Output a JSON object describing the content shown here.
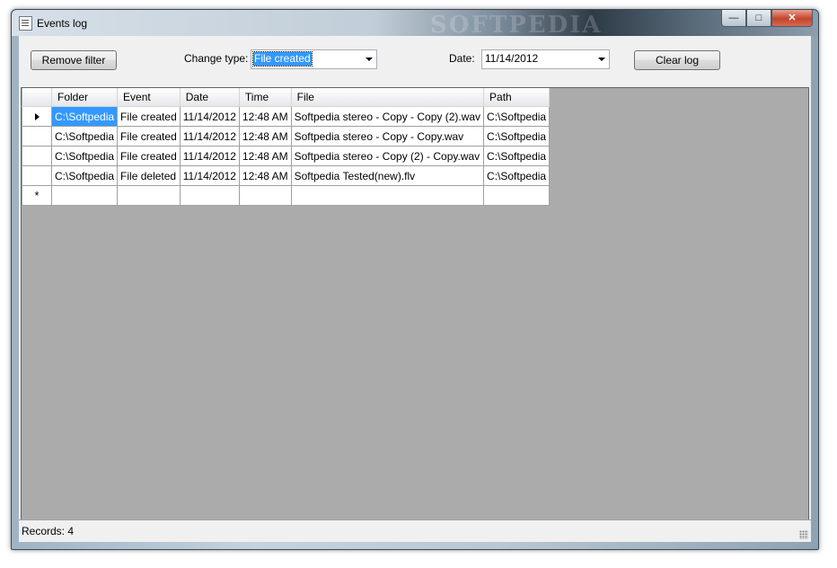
{
  "window": {
    "title": "Events log",
    "controls": {
      "minimize": "—",
      "maximize": "□",
      "close": "✕"
    }
  },
  "toolbar": {
    "remove_filter_label": "Remove filter",
    "change_type_label": "Change type:",
    "change_type_value": "File created",
    "date_label": "Date:",
    "date_value": "11/14/2012",
    "clear_log_label": "Clear log"
  },
  "grid": {
    "columns": [
      "Folder",
      "Event",
      "Date",
      "Time",
      "File",
      "Path"
    ],
    "rows": [
      [
        "C:\\Softpedia",
        "File created",
        "11/14/2012",
        "12:48 AM",
        "Softpedia stereo - Copy - Copy (2).wav",
        "C:\\Softpedia"
      ],
      [
        "C:\\Softpedia",
        "File created",
        "11/14/2012",
        "12:48 AM",
        "Softpedia stereo - Copy - Copy.wav",
        "C:\\Softpedia"
      ],
      [
        "C:\\Softpedia",
        "File created",
        "11/14/2012",
        "12:48 AM",
        "Softpedia stereo - Copy (2) - Copy.wav",
        "C:\\Softpedia"
      ],
      [
        "C:\\Softpedia",
        "File deleted",
        "11/14/2012",
        "12:48 AM",
        "Softpedia Tested(new).flv",
        "C:\\Softpedia"
      ]
    ],
    "new_row_marker": "*"
  },
  "status": {
    "records": "Records: 4"
  },
  "watermark": "SOFTPEDIA",
  "colors": {
    "selection": "#3399ff",
    "grid_background": "#ababab"
  }
}
